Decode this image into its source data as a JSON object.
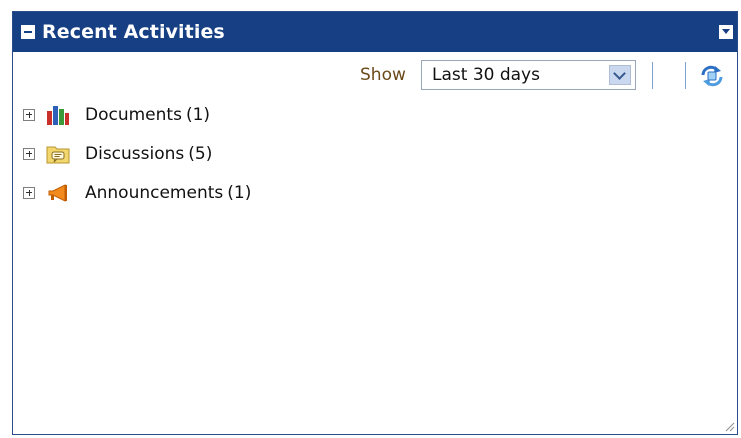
{
  "panel": {
    "title": "Recent Activities"
  },
  "toolbar": {
    "show_label": "Show",
    "range_select": {
      "value": "Last 30 days"
    }
  },
  "tree": {
    "items": [
      {
        "label": "Documents",
        "count": "(1)",
        "icon": "documents-books-icon"
      },
      {
        "label": "Discussions",
        "count": "(5)",
        "icon": "discussion-folder-icon"
      },
      {
        "label": "Announcements",
        "count": "(1)",
        "icon": "megaphone-icon"
      }
    ]
  },
  "colors": {
    "header_bg": "#173f83",
    "show_label": "#6b4a1a",
    "separator": "#7ea2cf"
  }
}
